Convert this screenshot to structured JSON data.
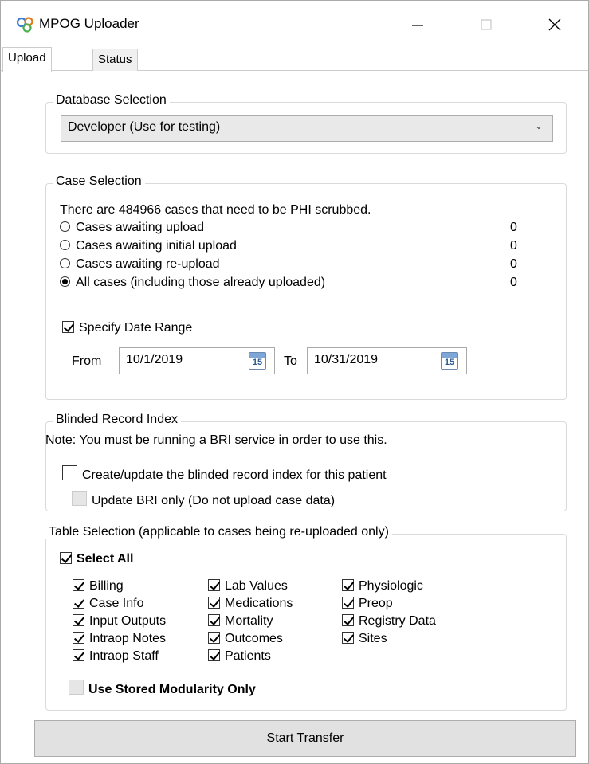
{
  "window": {
    "title": "MPOG Uploader",
    "controls": {
      "minimize": "minimize",
      "maximize": "maximize",
      "close": "close"
    }
  },
  "tabs": [
    {
      "label": "Upload",
      "active": true
    },
    {
      "label": "Status",
      "active": false
    }
  ],
  "database": {
    "group_title": "Database Selection",
    "selected": "Developer (Use for testing)"
  },
  "cases": {
    "group_title": "Case Selection",
    "summary": "There are 484966 cases that need to be PHI scrubbed.",
    "options": [
      {
        "label": "Cases awaiting upload",
        "count": "0",
        "selected": false
      },
      {
        "label": "Cases awaiting initial upload",
        "count": "0",
        "selected": false
      },
      {
        "label": "Cases awaiting re-upload",
        "count": "0",
        "selected": false
      },
      {
        "label": "All cases (including those already uploaded)",
        "count": "0",
        "selected": true
      }
    ],
    "date_range": {
      "checkbox_label": "Specify Date Range",
      "checked": true,
      "from_label": "From",
      "from_value": "10/1/2019",
      "to_label": "To",
      "to_value": "10/31/2019",
      "calendar_day": "15"
    }
  },
  "bri": {
    "group_title": "Blinded Record Index",
    "note": "Note: You must be running a BRI service in order to use this.",
    "create_label": "Create/update the blinded record index for this patient",
    "update_only_label": "Update BRI only (Do not upload case data)"
  },
  "tables": {
    "group_title": "Table Selection (applicable to cases being re-uploaded only)",
    "select_all_label": "Select All",
    "columns": [
      [
        "Billing",
        "Case Info",
        "Input Outputs",
        "Intraop Notes",
        "Intraop Staff"
      ],
      [
        "Lab Values",
        "Medications",
        "Mortality",
        "Outcomes",
        "Patients"
      ],
      [
        "Physiologic",
        "Preop",
        "Registry Data",
        "Sites"
      ]
    ],
    "stored_modularity_label": "Use Stored Modularity Only"
  },
  "start_button": "Start Transfer"
}
